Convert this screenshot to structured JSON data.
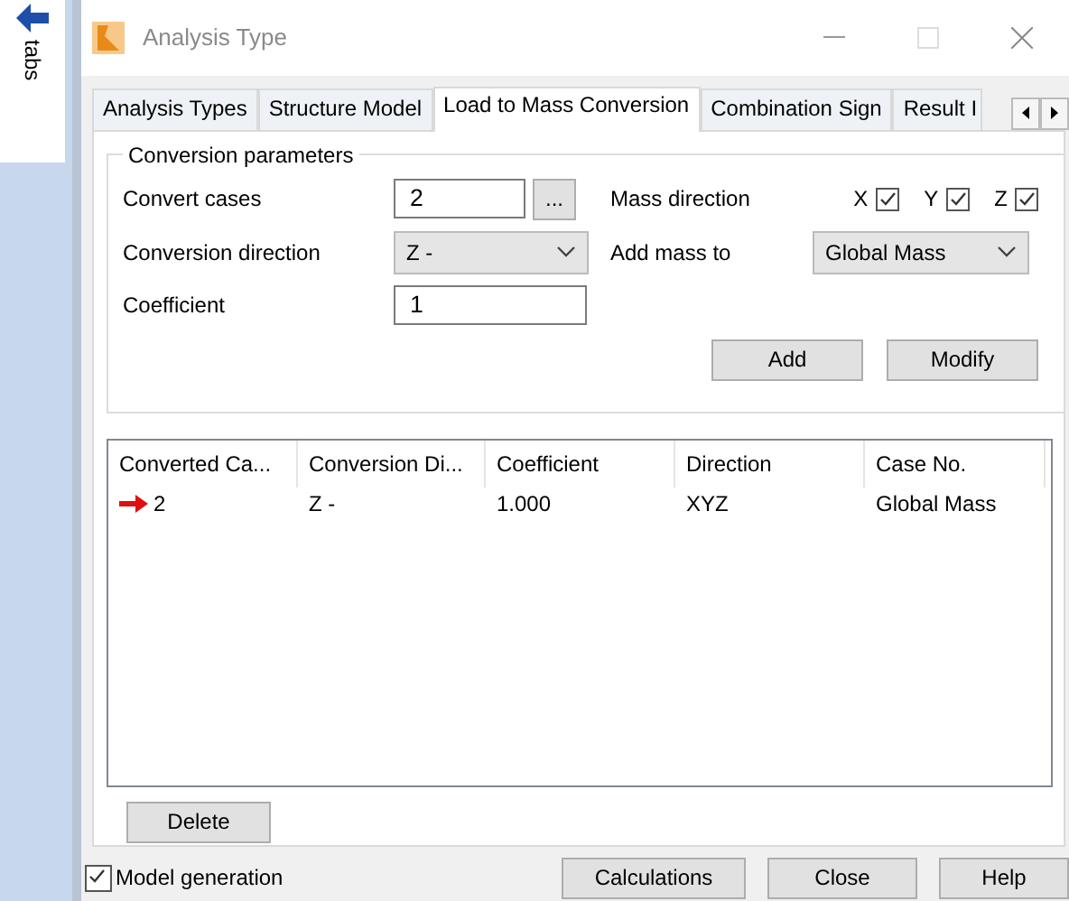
{
  "side_panel": {
    "label": "tabs"
  },
  "window": {
    "title": "Analysis Type"
  },
  "tabs": [
    {
      "label": "Analysis Types",
      "selected": false
    },
    {
      "label": "Structure Model",
      "selected": false
    },
    {
      "label": "Load to Mass Conversion",
      "selected": true
    },
    {
      "label": "Combination Sign",
      "selected": false
    },
    {
      "label": "Result I",
      "selected": false
    }
  ],
  "group": {
    "title": "Conversion parameters",
    "convert_cases": {
      "label": "Convert cases",
      "value": "2",
      "browse": "..."
    },
    "conversion_direction": {
      "label": "Conversion direction",
      "value": "Z -"
    },
    "coefficient": {
      "label": "Coefficient",
      "value": "1"
    },
    "mass_direction": {
      "label": "Mass direction",
      "axes": [
        {
          "label": "X",
          "checked": true
        },
        {
          "label": "Y",
          "checked": true
        },
        {
          "label": "Z",
          "checked": true
        }
      ]
    },
    "add_mass_to": {
      "label": "Add mass to",
      "value": "Global Mass"
    },
    "buttons": [
      "Add",
      "Modify"
    ]
  },
  "table": {
    "columns": [
      "Converted Ca...",
      "Conversion Di...",
      "Coefficient",
      "Direction",
      "Case No."
    ],
    "rows": [
      {
        "current": true,
        "cells": [
          "2",
          "Z -",
          "1.000",
          "XYZ",
          "Global Mass"
        ]
      }
    ]
  },
  "delete_button": "Delete",
  "model_generation": {
    "label": "Model generation",
    "checked": true
  },
  "footer_buttons": [
    "Calculations",
    "Close",
    "Help"
  ]
}
